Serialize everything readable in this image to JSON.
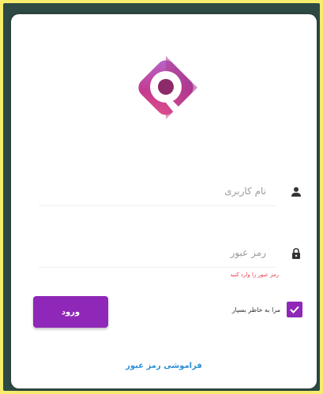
{
  "colors": {
    "accent": "#8f27b8",
    "error": "#e53b4a",
    "link": "#2d8fd5"
  },
  "logo": {
    "icon": "q-logo-icon"
  },
  "username": {
    "placeholder": "نام کاربری",
    "value": "",
    "icon": "user-icon"
  },
  "password": {
    "placeholder": "رمز عبور",
    "value": "",
    "icon": "lock-icon",
    "error": "رمز عبور را وارد کنید"
  },
  "remember": {
    "label": "مرا به خاطر بسپار",
    "checked": true
  },
  "login_button": {
    "label": "ورود"
  },
  "forgot_link": {
    "label": "فراموشی رمز عبور"
  }
}
